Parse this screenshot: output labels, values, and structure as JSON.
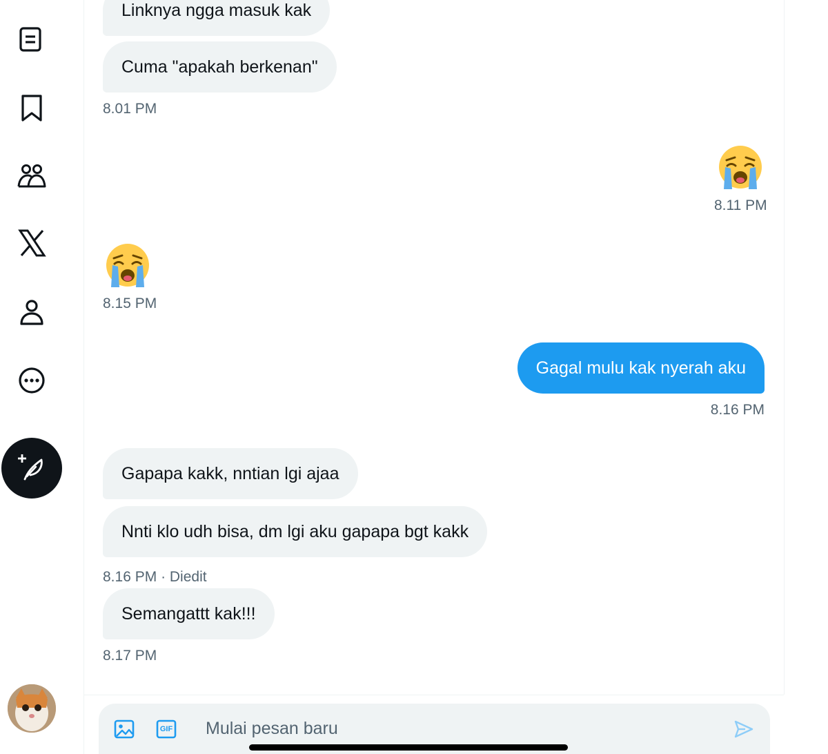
{
  "sidebar": {
    "icons": [
      "lists-icon",
      "bookmark-icon",
      "communities-icon",
      "x-logo-icon",
      "profile-icon",
      "more-icon"
    ],
    "compose_icon": "compose-post-icon",
    "accent": "#0f1419"
  },
  "messages": [
    {
      "side": "in",
      "text": "Linknya ngga masuk kak"
    },
    {
      "side": "in",
      "text": "Cuma \"apakah berkenan\""
    },
    {
      "side": "in",
      "time": "8.01 PM"
    },
    {
      "side": "out",
      "emoji": "loudly-crying-face",
      "time": "8.11 PM"
    },
    {
      "side": "in",
      "emoji": "loudly-crying-face",
      "time": "8.15 PM"
    },
    {
      "side": "out",
      "text": "Gagal mulu kak nyerah aku",
      "time": "8.16 PM"
    },
    {
      "side": "in",
      "text": "Gapapa kakk, nntian lgi ajaa"
    },
    {
      "side": "in",
      "text": "Nnti klo udh bisa, dm lgi aku gapapa bgt kakk"
    },
    {
      "side": "in",
      "time": "8.16 PM",
      "edited": "Diedit"
    },
    {
      "side": "in",
      "text": "Semangattt kak!!!",
      "time": "8.17 PM"
    }
  ],
  "composer": {
    "placeholder": "Mulai pesan baru",
    "icons": [
      "image-icon",
      "gif-icon",
      "send-icon"
    ],
    "gif_label": "GIF"
  },
  "colors": {
    "outgoing_bubble": "#1d9bf0",
    "incoming_bubble": "#eff3f4",
    "timestamp": "#536471"
  }
}
